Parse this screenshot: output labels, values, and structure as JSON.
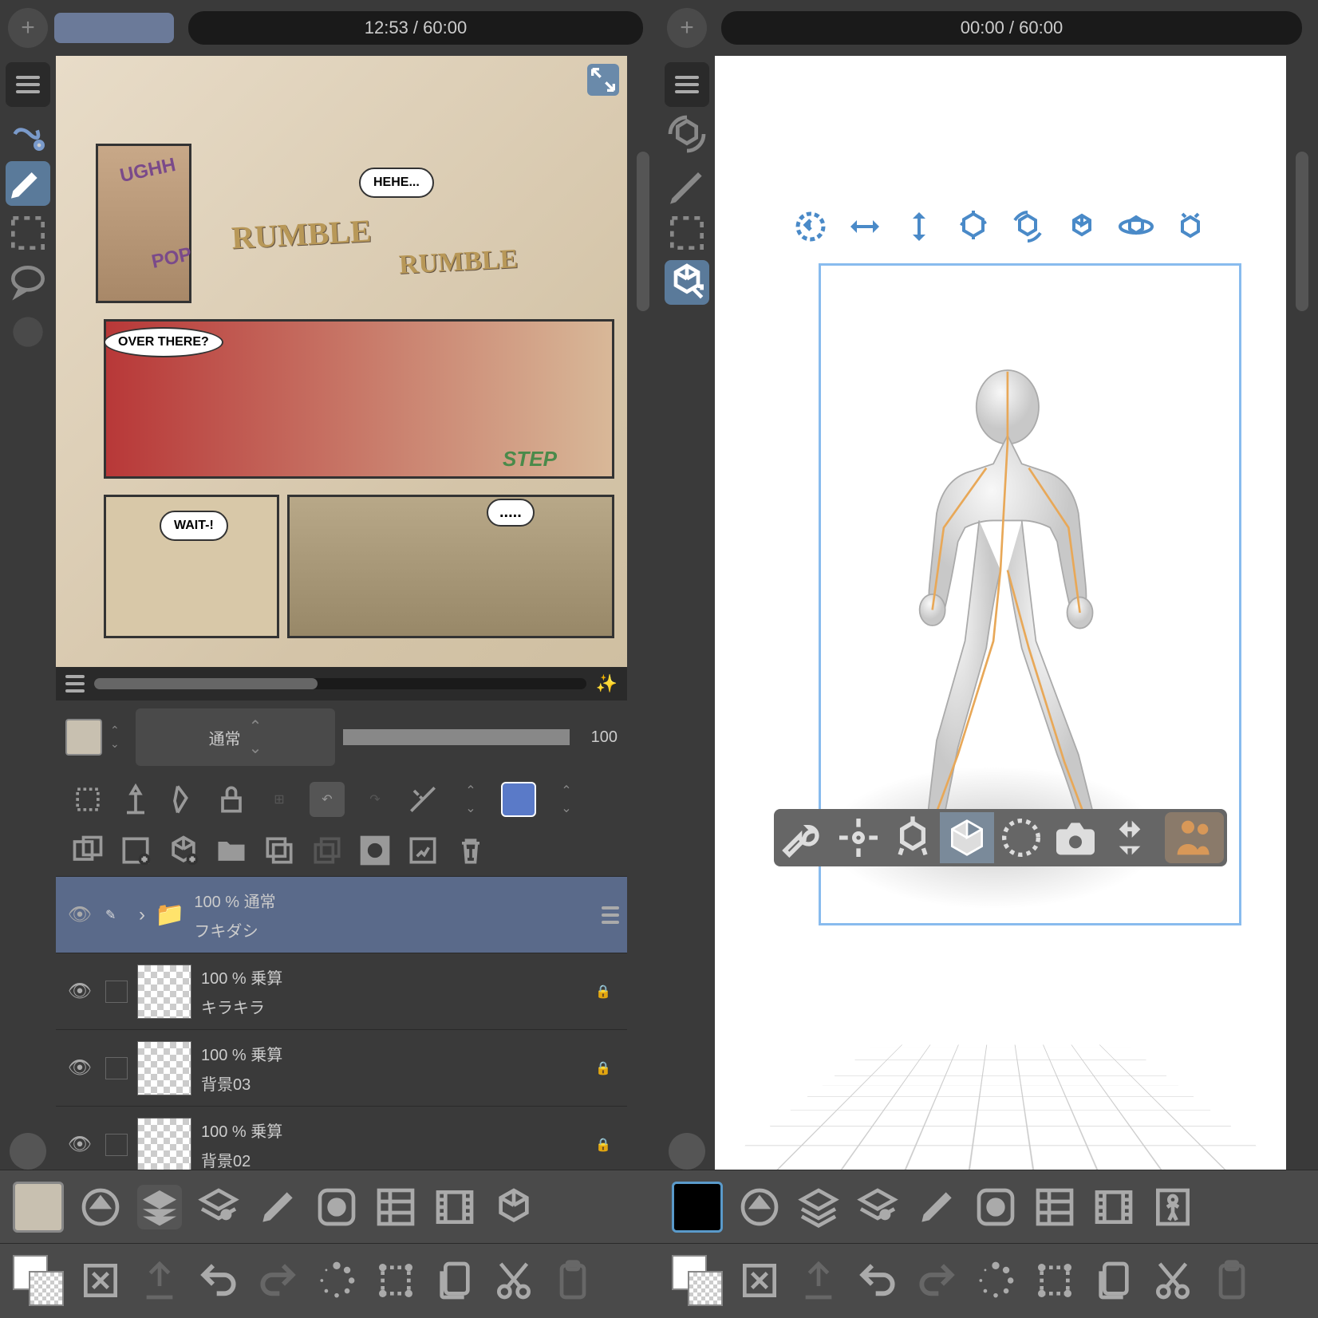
{
  "left_pane": {
    "time": "12:53 / 60:00",
    "comic": {
      "bubbles": [
        "HEHE...",
        "OVER THERE?",
        "WAIT-!",
        "....."
      ],
      "sfx": [
        "RUMBLE",
        "RUMBLE",
        "UGHH",
        "POP",
        "STEP"
      ]
    },
    "layer_panel": {
      "blend_mode": "通常",
      "opacity": "100",
      "layers": [
        {
          "opacity": "100 %",
          "blend": "通常",
          "name": "フキダシ",
          "folder": true
        },
        {
          "opacity": "100 %",
          "blend": "乗算",
          "name": "キラキラ"
        },
        {
          "opacity": "100 %",
          "blend": "乗算",
          "name": "背景03"
        },
        {
          "opacity": "100 %",
          "blend": "乗算",
          "name": "背景02"
        }
      ]
    }
  },
  "right_pane": {
    "time": "00:00 / 60:00"
  },
  "colors": {
    "left_swatch": "#c8c0b0",
    "right_swatch": "#000000",
    "mini_left": "#ffffff",
    "mini_right": "#ffffff"
  }
}
